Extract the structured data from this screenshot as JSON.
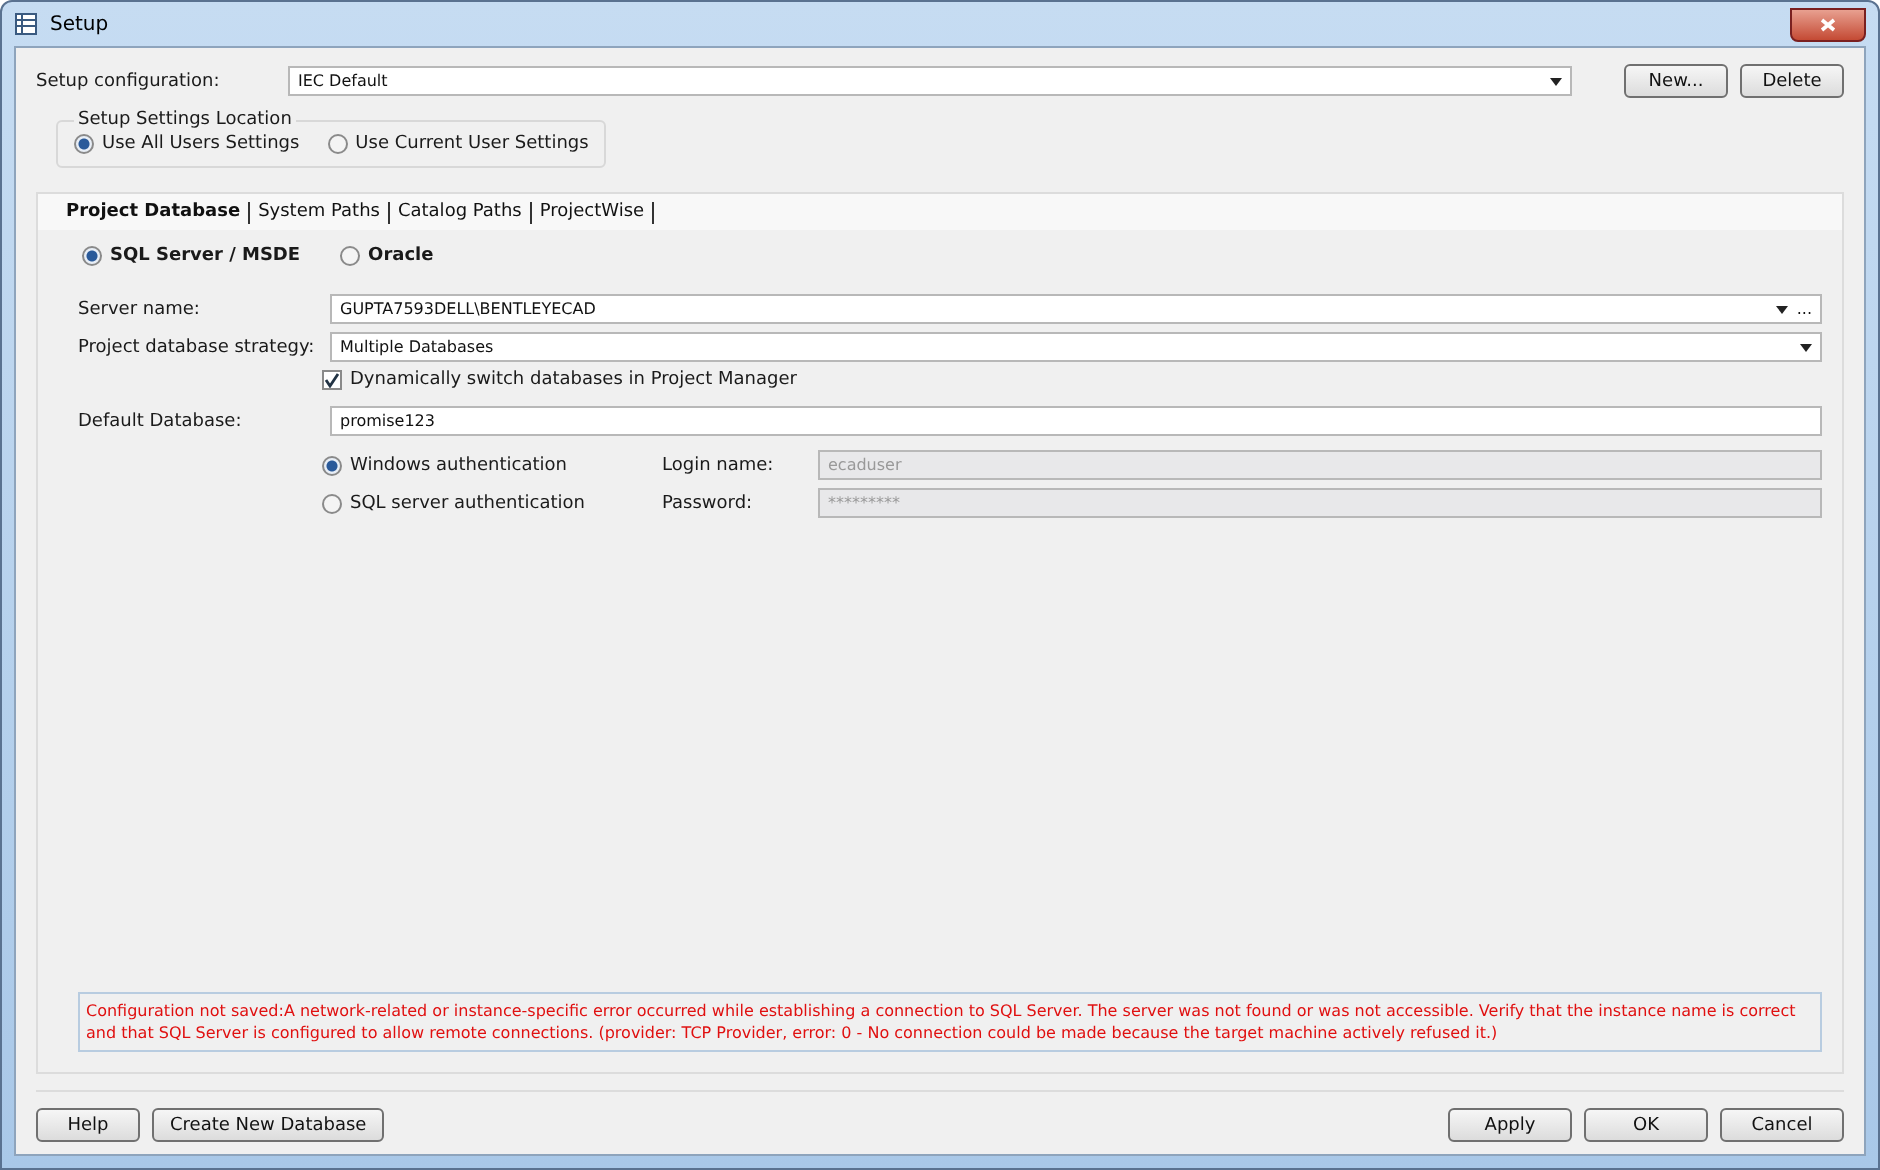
{
  "window": {
    "title": "Setup"
  },
  "setup_configuration": {
    "label": "Setup configuration:",
    "value": "IEC Default",
    "buttons": [
      "New...",
      "Delete"
    ]
  },
  "settings_location": {
    "title": "Setup Settings Location",
    "options": [
      {
        "label": "Use All Users Settings",
        "selected": true
      },
      {
        "label": "Use Current User Settings",
        "selected": false
      }
    ]
  },
  "tabs": [
    {
      "label": "Project Database",
      "selected": true
    },
    {
      "label": "System Paths",
      "selected": false
    },
    {
      "label": "Catalog Paths",
      "selected": false
    },
    {
      "label": "ProjectWise",
      "selected": false
    }
  ],
  "database_type": [
    {
      "label": "SQL Server / MSDE",
      "selected": true
    },
    {
      "label": "Oracle",
      "selected": false
    }
  ],
  "server_name": {
    "label": "Server name:",
    "value": "GUPTA7593DELL\\BENTLEYECAD",
    "browse": "..."
  },
  "strategy": {
    "label": "Project database strategy:",
    "value": "Multiple Databases"
  },
  "dynamic_switch": {
    "label": "Dynamically switch databases in Project Manager",
    "checked": true
  },
  "default_database": {
    "label": "Default Database:",
    "value": "promise123"
  },
  "authentication": [
    {
      "label": "Windows authentication",
      "selected": true,
      "field_label": "Login name:",
      "field_value": "ecaduser"
    },
    {
      "label": "SQL server authentication",
      "selected": false,
      "field_label": "Password:",
      "field_value": "*********"
    }
  ],
  "error_message": "Configuration not saved:A network-related or instance-specific error occurred while establishing a connection to SQL Server. The server was not found or was not accessible. Verify that the instance name is correct and that SQL Server is configured to allow remote connections. (provider: TCP Provider, error: 0 - No connection could be made because the target machine actively refused it.)",
  "footer_left": [
    "Help",
    "Create New Database"
  ],
  "footer_right": [
    "Apply",
    "OK",
    "Cancel"
  ]
}
